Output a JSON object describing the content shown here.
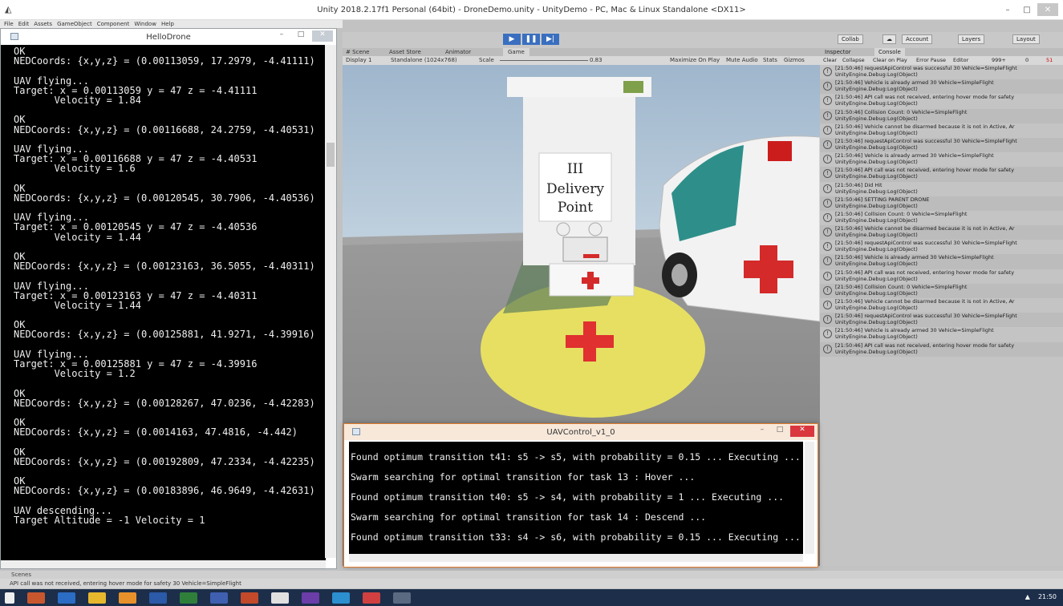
{
  "window": {
    "title": "Unity 2018.2.17f1 Personal (64bit) - DroneDemo.unity - UnityDemo - PC, Mac & Linux Standalone <DX11>",
    "min": "–",
    "max": "□",
    "close": "✕"
  },
  "menu": [
    "File",
    "Edit",
    "Assets",
    "GameObject",
    "Component",
    "Window",
    "Help"
  ],
  "hello_drone": {
    "title": "HelloDrone",
    "lines": [
      "OK",
      "NEDCoords: {x,y,z} = (0.00113059, 17.2979, -4.41111)",
      "",
      "UAV flying...",
      "Target: x = 0.00113059 y = 47 z = -4.41111",
      "       Velocity = 1.84",
      "",
      "OK",
      "NEDCoords: {x,y,z} = (0.00116688, 24.2759, -4.40531)",
      "",
      "UAV flying...",
      "Target: x = 0.00116688 y = 47 z = -4.40531",
      "       Velocity = 1.6",
      "",
      "OK",
      "NEDCoords: {x,y,z} = (0.00120545, 30.7906, -4.40536)",
      "",
      "UAV flying...",
      "Target: x = 0.00120545 y = 47 z = -4.40536",
      "       Velocity = 1.44",
      "",
      "OK",
      "NEDCoords: {x,y,z} = (0.00123163, 36.5055, -4.40311)",
      "",
      "UAV flying...",
      "Target: x = 0.00123163 y = 47 z = -4.40311",
      "       Velocity = 1.44",
      "",
      "OK",
      "NEDCoords: {x,y,z} = (0.00125881, 41.9271, -4.39916)",
      "",
      "UAV flying...",
      "Target: x = 0.00125881 y = 47 z = -4.39916",
      "       Velocity = 1.2",
      "",
      "OK",
      "NEDCoords: {x,y,z} = (0.00128267, 47.0236, -4.42283)",
      "",
      "OK",
      "NEDCoords: {x,y,z} = (0.0014163, 47.4816, -4.442)",
      "",
      "OK",
      "NEDCoords: {x,y,z} = (0.00192809, 47.2334, -4.42235)",
      "",
      "OK",
      "NEDCoords: {x,y,z} = (0.00183896, 46.9649, -4.42631)",
      "",
      "UAV descending...",
      "Target Altitude = -1 Velocity = 1"
    ]
  },
  "tabs": {
    "scene": "# Scene",
    "asset_store": "Asset Store",
    "animator": "Animator",
    "game": "Game"
  },
  "game_bar": {
    "display": "Display 1",
    "resolution": "Standalone (1024x768)",
    "scale_label": "Scale",
    "scale_value": "0.83",
    "maximize": "Maximize On Play",
    "mute": "Mute Audio",
    "stats": "Stats",
    "gizmos": "Gizmos"
  },
  "scene_sign": {
    "line1": "III",
    "line2": "Delivery",
    "line3": "Point"
  },
  "right_toolbar": {
    "collab": "Collab",
    "account": "Account",
    "layers": "Layers",
    "layout": "Layout"
  },
  "panel_tabs": {
    "inspector": "Inspector",
    "console": "Console"
  },
  "console_bar": {
    "clear": "Clear",
    "collapse": "Collapse",
    "clear_on_play": "Clear on Play",
    "error_pause": "Error Pause",
    "editor": "Editor",
    "info_count": "999+",
    "warn_count": "0",
    "error_count": "51"
  },
  "console_logs": [
    "[21:50:46] requestApiControl was successful 30 Vehicle=SimpleFlight",
    "[21:50:46] Vehicle is already armed 30 Vehicle=SimpleFlight",
    "[21:50:46] API call was not received, entering hover mode for safety",
    "[21:50:46] Collision Count: 0 Vehicle=SimpleFlight",
    "[21:50:46] Vehicle cannot be disarmed because it is not in Active, Ar",
    "[21:50:46] requestApiControl was successful 30 Vehicle=SimpleFlight",
    "[21:50:46] Vehicle is already armed 30 Vehicle=SimpleFlight",
    "[21:50:46] API call was not received, entering hover mode for safety",
    "[21:50:46] Did Hit",
    "[21:50:46] SETTING PARENT DRONE",
    "[21:50:46] Collision Count: 0 Vehicle=SimpleFlight",
    "[21:50:46] Vehicle cannot be disarmed because it is not in Active, Ar",
    "[21:50:46] requestApiControl was successful 30 Vehicle=SimpleFlight",
    "[21:50:46] Vehicle is already armed 30 Vehicle=SimpleFlight",
    "[21:50:46] API call was not received, entering hover mode for safety",
    "[21:50:46] Collision Count: 0 Vehicle=SimpleFlight",
    "[21:50:46] Vehicle cannot be disarmed because it is not in Active, Ar",
    "[21:50:46] requestApiControl was successful 30 Vehicle=SimpleFlight",
    "[21:50:46] Vehicle is already armed 30 Vehicle=SimpleFlight",
    "[21:50:46] API call was not received, entering hover mode for safety"
  ],
  "console_sub": "UnityEngine.Debug:Log(Object)",
  "uav": {
    "title": "UAVControl_v1_0",
    "lines": [
      "Found optimum transition t41: s5 -> s5, with probability = 0.15 ... Executing ...",
      "Swarm searching for optimal transition for task 13 : Hover ...",
      "Found optimum transition t40: s5 -> s4, with probability = 1 ... Executing ...",
      "Swarm searching for optimal transition for task 14 : Descend ...",
      "Found optimum transition t33: s4 -> s6, with probability = 0.15 ... Executing ..."
    ]
  },
  "scenes_label": "Scenes",
  "status_text": "API call was not received, entering hover mode for safety 30 Vehicle=SimpleFlight",
  "clock": "21:50"
}
